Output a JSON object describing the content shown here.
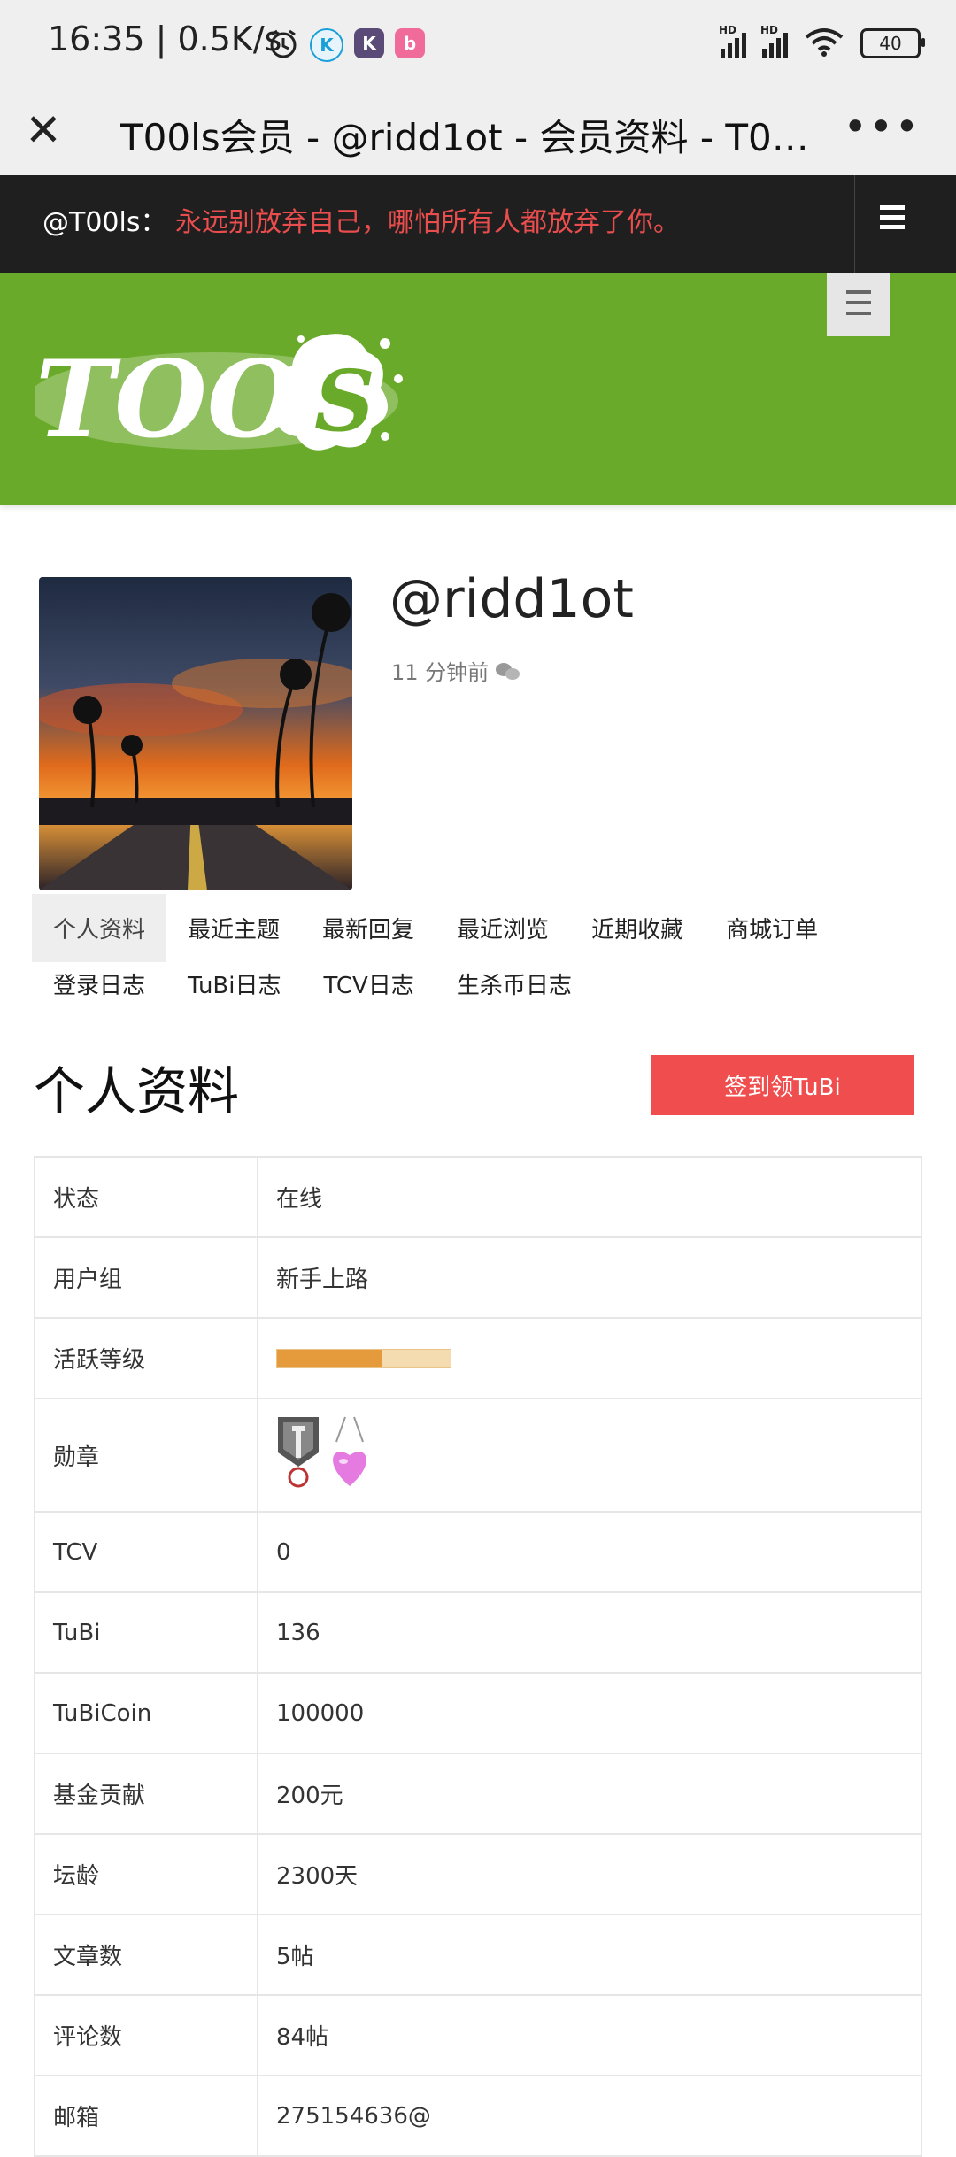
{
  "status_bar": {
    "time_speed": "16:35 | 0.5K/s",
    "network_label": "HD",
    "battery": "40"
  },
  "titlebar": {
    "title": "T00ls会员 - @ridd1ot - 会员资料 - T00ls…"
  },
  "notice": {
    "label": "@T00ls：",
    "slogan": "永远别放弃自己，哪怕所有人都放弃了你。"
  },
  "header": {
    "logo_text": "TOOLS",
    "brand_color": "#6aaa2a"
  },
  "profile": {
    "username": "@ridd1ot",
    "last_seen": "11 分钟前"
  },
  "tabs": {
    "row1": [
      "个人资料",
      "最近主题",
      "最新回复",
      "最近浏览",
      "近期收藏",
      "商城订单"
    ],
    "row2": [
      "登录日志",
      "TuBi日志",
      "TCV日志",
      "生杀币日志"
    ]
  },
  "section": {
    "title": "个人资料",
    "signin_button": "签到领TuBi"
  },
  "info_rows": [
    {
      "key": "状态",
      "value": "在线"
    },
    {
      "key": "用户组",
      "value": "新手上路"
    },
    {
      "key": "活跃等级",
      "value": "",
      "level_fraction": 0.6
    },
    {
      "key": "勋章",
      "value": ""
    },
    {
      "key": "TCV",
      "value": "0"
    },
    {
      "key": "TuBi",
      "value": "136"
    },
    {
      "key": "TuBiCoin",
      "value": "100000"
    },
    {
      "key": "基金贡献",
      "value": "200元"
    },
    {
      "key": "坛龄",
      "value": "2300天"
    },
    {
      "key": "文章数",
      "value": "5帖"
    },
    {
      "key": "评论数",
      "value": "84帖"
    },
    {
      "key": "邮箱",
      "value": "275154636@"
    }
  ]
}
